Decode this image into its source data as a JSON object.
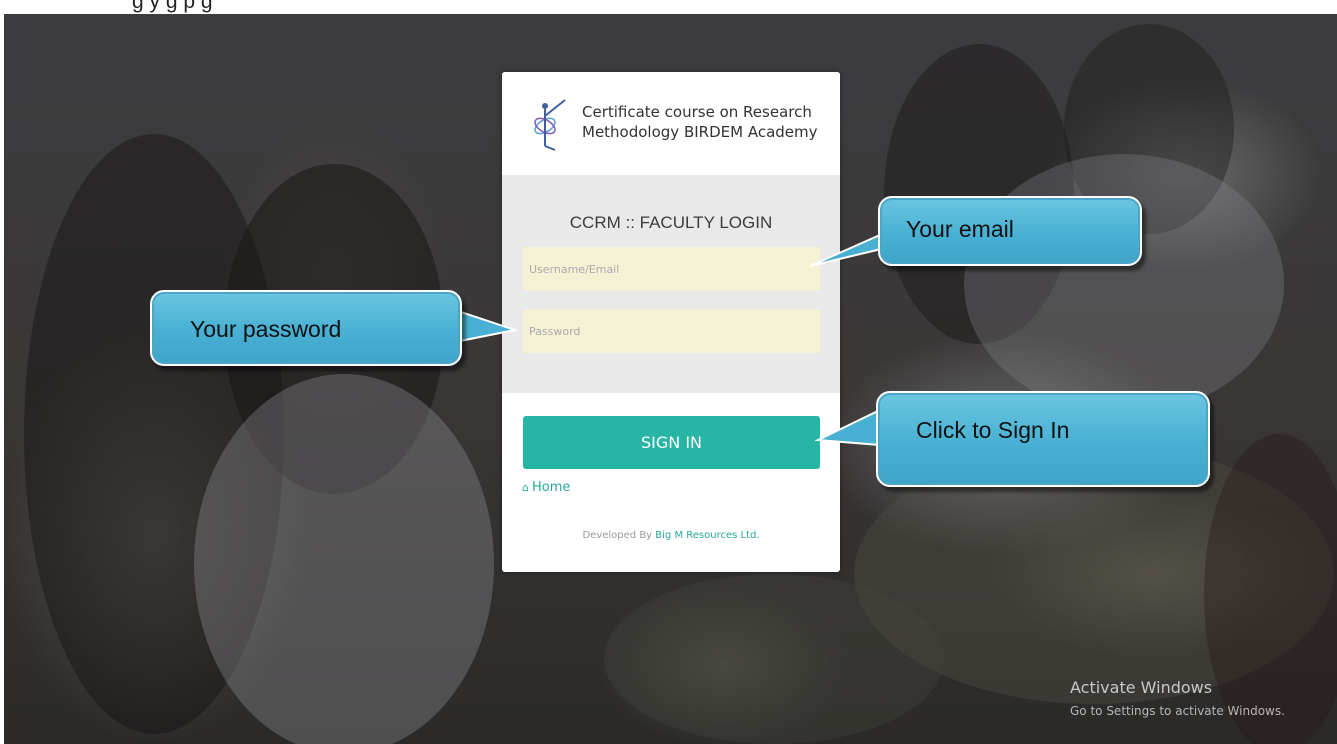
{
  "caption": {
    "text": "g      y      g      p g"
  },
  "brand": {
    "line1": "Certificate course on Research",
    "line2": "Methodology BIRDEM Academy",
    "logo_icon": "birdem-academy-logo"
  },
  "form": {
    "title": "CCRM :: FACULTY LOGIN",
    "username_placeholder": "Username/Email",
    "password_placeholder": "Password",
    "signin_label": "SIGN IN",
    "home_icon": "home-icon",
    "home_label": "Home"
  },
  "footer": {
    "prefix": "Developed By",
    "company": "Big M Resources Ltd."
  },
  "callouts": {
    "email": "Your email",
    "password": "Your password",
    "signin": "Click to Sign In"
  },
  "watermark": {
    "line1": "Activate Windows",
    "line2": "Go to Settings to activate Windows."
  },
  "colors": {
    "accent": "#27b5a5",
    "callout": "#48b0d3",
    "field_bg": "#f5f1d5"
  }
}
